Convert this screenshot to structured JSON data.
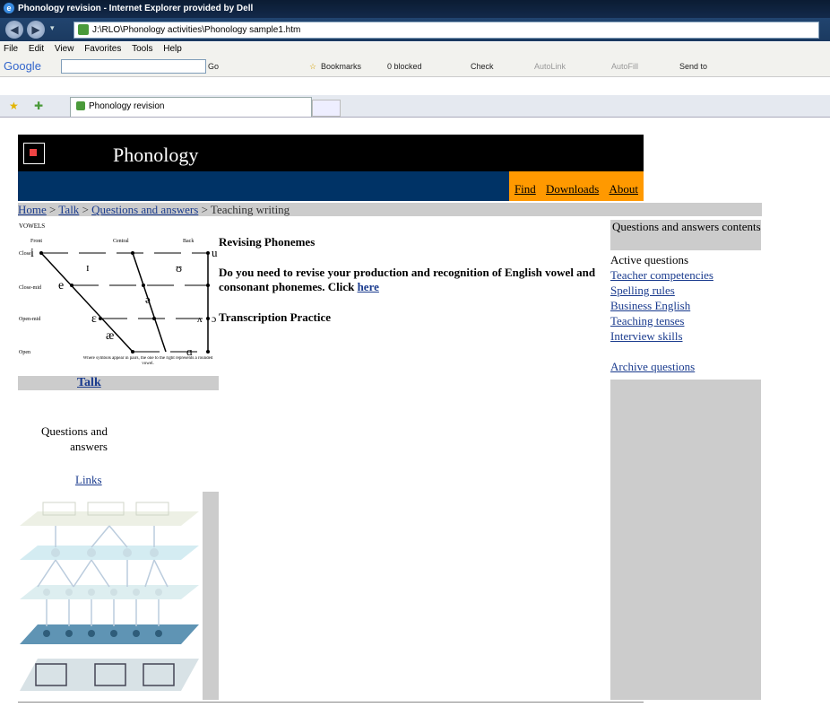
{
  "window": {
    "title": "Phonology revision - Internet Explorer provided by Dell"
  },
  "address": {
    "url": "J:\\RLO\\Phonology activities\\Phonology sample1.htm"
  },
  "menu": [
    "File",
    "Edit",
    "View",
    "Favorites",
    "Tools",
    "Help"
  ],
  "google_bar": {
    "logo": "Google",
    "go": "Go",
    "bookmarks": "Bookmarks",
    "blocked": "0 blocked",
    "check": "Check",
    "autolink": "AutoLink",
    "autofill": "AutoFill",
    "sendto": "Send to"
  },
  "tab": {
    "label": "Phonology revision"
  },
  "header": {
    "title": "Phonology"
  },
  "nav": {
    "find": "Find",
    "downloads": "Downloads",
    "about": "About"
  },
  "breadcrumb": {
    "home": "Home",
    "talk": "Talk",
    "qa": "Questions and answers",
    "current": "Teaching writing",
    "sep": " > "
  },
  "vowel_chart": {
    "title": "VOWELS",
    "cols": [
      "Front",
      "Central",
      "Back"
    ],
    "rows": [
      "Close",
      "Close-mid",
      "Open-mid",
      "Open"
    ],
    "note": "Where symbols appear in pairs, the one to the right represents a rounded vowel.",
    "symbols": [
      "i",
      "u",
      "ɪ",
      "ʊ",
      "e",
      "ə",
      "ɛ",
      "ʌ",
      "ɔ",
      "æ",
      "ɑ"
    ]
  },
  "left": {
    "talk": "Talk",
    "qa": "Questions and answers",
    "links": "Links"
  },
  "main": {
    "heading": "Revising Phonemes",
    "para": "Do you need to revise your production and recognition of English vowel and consonant phonemes. Click ",
    "link": "here",
    "heading2": "Transcription Practice"
  },
  "right": {
    "heading": "Questions and answers contents",
    "active": "Active questions",
    "items": [
      "Teacher competencies",
      "Spelling rules",
      "Business English",
      "Teaching tenses",
      "Interview skills"
    ],
    "archive": "Archive questions"
  },
  "colors": {
    "header_bg": "#000000",
    "nav_bg": "#003366",
    "nav_links_bg": "#ff9900",
    "sidebar_gray": "#cccccc",
    "link": "#1a3b8e"
  }
}
